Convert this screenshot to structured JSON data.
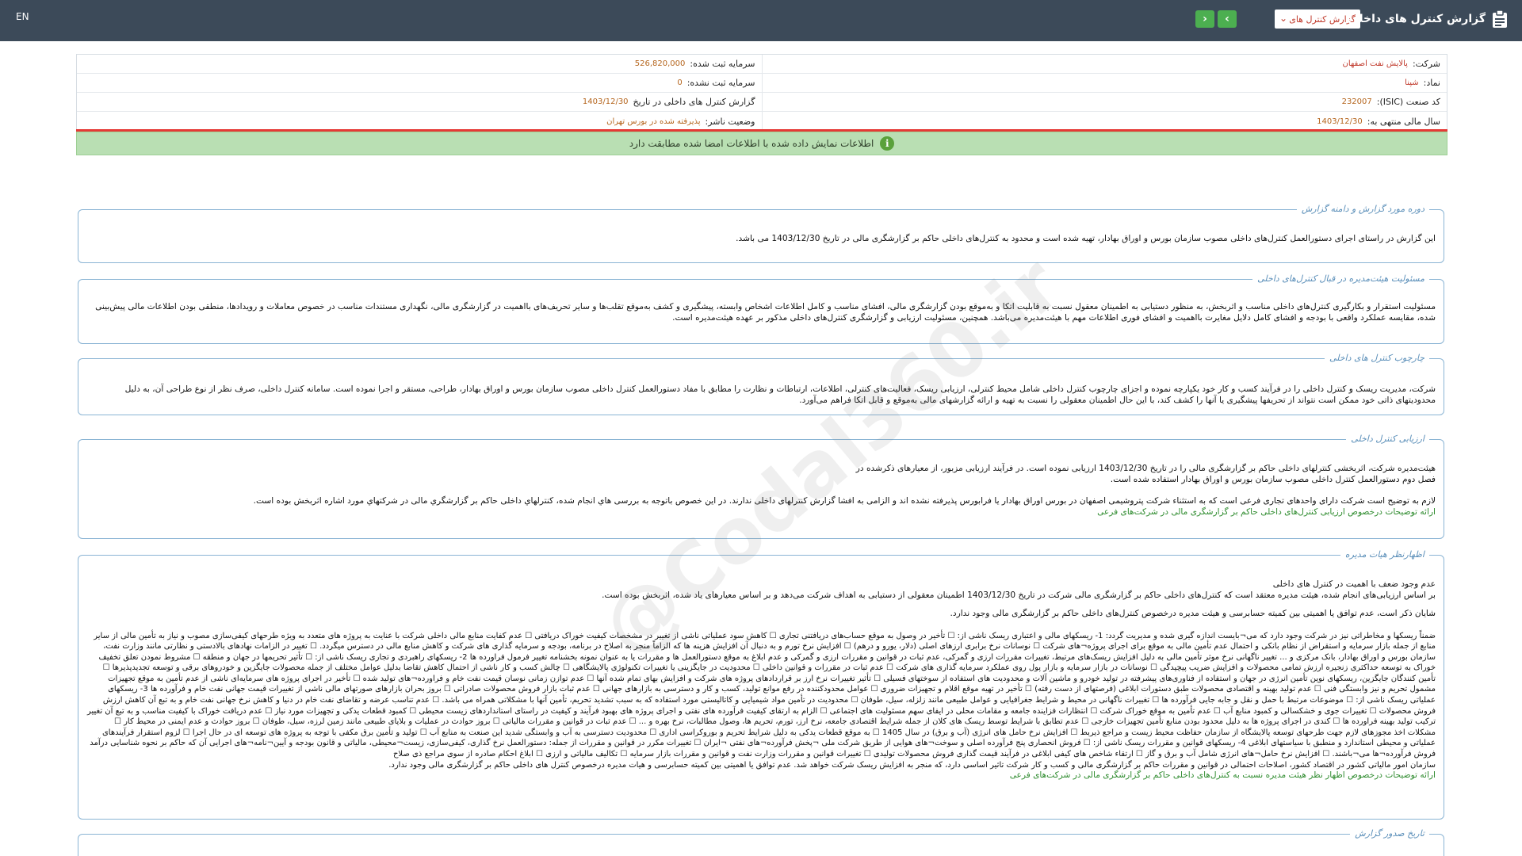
{
  "topbar": {
    "lang": "EN",
    "title": "گزارش کنترل های داخلی",
    "select_value": "گزارش کنترل های",
    "prev_label": "›",
    "next_label": "‹",
    "icon": "document-clipboard-icon",
    "bg_color": "#3c4a59"
  },
  "info": {
    "company_label": "شرکت:",
    "company_value": "پالایش نفت اصفهان",
    "capital_registered_label": "سرمایه ثبت شده:",
    "capital_registered_value": "526,820,000",
    "symbol_label": "نماد:",
    "symbol_value": "شپنا",
    "capital_unregistered_label": "سرمایه ثبت نشده:",
    "capital_unregistered_value": "0",
    "isic_label": "کد صنعت (ISIC):",
    "isic_value": "232007",
    "report_label": "گزارش کنترل های داخلی در تاریخ",
    "report_value": "1403/12/30",
    "fiscal_label": "سال مالی منتهی به:",
    "fiscal_value": "1403/12/30",
    "status_label": "وضعیت ناشر:",
    "status_value": "پذیرفته شده در بورس تهران"
  },
  "notice": {
    "text": "اطلاعات نمایش داده شده با اطلاعات امضا شده مطابقت دارد",
    "icon": "info-icon",
    "bg_color": "#b9dfb3"
  },
  "watermark": "@Codal360.ir",
  "sections": {
    "scope": {
      "title": "دوره مورد گزارش و دامنه گزارش",
      "text": "این گزارش در راستای اجرای دستورالعمل کنترل‌های داخلی مصوب سازمان بورس و اوراق بهادار، تهیه شده است و محدود به کنترل‌های داخلی حاکم بر گزارشگری مالی در تاریخ 1403/12/30 می باشد."
    },
    "board": {
      "title": "مسئولیت هیئت‌مدیره در قبال کنترل‌های داخلی",
      "text": "مسئولیت استقرار و بکارگیری کنترل‌های داخلی مناسب و اثربخش، به منظور دستیابی به اطمینان معقول نسبت به قابلیت اتکا و به‌موقع بودن گزارشگری مالی، افشای مناسب و کامل اطلاعات اشخاص وابسته، پیشگیری و کشف به‌موقع تقلب‌ها و سایر تحریف‌های بااهمیت در گزارشگری مالی، نگهداری مستندات مناسب در خصوص معاملات و رویدادها، منطقی بودن اطلاعات مالی پیش‌بینی شده، مقایسه عملکرد واقعی با بودجه و افشای کامل دلایل مغایرت بااهمیت و افشای فوری اطلاعات مهم با هیئت‌مدیره می‌باشد. همچنین، مسئولیت ارزیابی و گزارشگری کنترل‌های داخلی مذکور بر عهده هیئت‌مدیره است."
    },
    "framework": {
      "title": "چارچوب کنترل های داخلی",
      "text": "شرکت، مدیریت ریسک و کنترل داخلی را در فرآیند کسب و کار خود یکپارچه نموده و اجزای چارچوب کنترل داخلی شامل محیط کنترلی، ارزیابی ریسک، فعالیت‌های کنترلی، اطلاعات، ارتباطات و نظارت را مطابق با مفاد دستورالعمل کنترل داخلی مصوب سازمان بورس و اوراق بهادار، طراحی، مستقر و اجرا نموده است. سامانه کنترل داخلی، صرف نظر از نوع طراحی آن، به دلیل محدودیتهای ذاتی خود ممکن است نتواند از تحریفها پیشگیری یا آنها را کشف کند، با این حال اطمینان معقولی را نسبت به تهیه و ارائه گزارشهای مالی به‌موقع و قابل اتکا فراهم می‌آورد."
    },
    "evaluation": {
      "title": "ارزیابی کنترل داخلی",
      "line1": "هیئت‌مدیره شرکت، اثربخشی کنترلهای داخلی حاکم بر گزارشگری مالی را در تاریخ 1403/12/30 ارزیابی نموده است. در فرآیند ارزیابی مزبور، از معیارهای ذکرشده در",
      "line2": "فصل دوم دستورالعمل کنترل داخلی مصوب سازمان بورس و اوراق بهادار استفاده شده است.",
      "line3": "لازم به توضیح است شرکت دارای واحدهای تجاری فرعی است که به استثناء شرکت پتروشیمی اصفهان در بورس اوراق بهادار یا فرابورس پذیرفته نشده اند و الزامی به افشا گزارش کنترلهای داخلی ندارند. در این خصوص باتوجه به بررسی هاي انجام شده، کنترلهاي داخلی حاکم بر گزارشگري مالی در شرکتهاي مورد اشاره اثربخش بوده است.",
      "link": "ارائه توضیحات درخصوص ارزیابی کنترل‌های داخلی حاکم بر گزارشگری مالی در شرکت‌های فرعی"
    },
    "opinion": {
      "title": "اظهارنظر هیات مدیره",
      "line1": "عدم وجود ضعف با اهمیت در کنترل های داخلی",
      "line2": "بر اساس ارزیابی‌های انجام شده، هیئت مدیره معتقد است که کنترل‌های داخلی حاکم بر گزارشگری مالی شرکت در تاریخ 1403/12/30 اطمینان معقولی از دستیابی به اهداف شرکت می‌دهد و بر اساس معیارهای یاد شده، اثربخش بوده است.",
      "line3": "شایان ذکر است، عدم توافق یا اهمیتی بین کمیته حسابرسی و هیئت مدیره درخصوص کنترل‌های داخلی حاکم بر گزارشگری مالی وجود ندارد.",
      "para": "ضمناً ریسکها و مخاطراتی نیز در شرکت وجود دارد که می¬بایست اندازه گیری شده و مدیریت گردد: 1- ریسکهای مالی و اعتباری ریسک ناشی از: ☐ تأخیر در وصول به موقع حساب‌های دریافتنی تجاری ☐ کاهش سود عملیاتی ناشی از تغییر در مشخصات کیفیت خوراک دریافتی ☐ عدم کفایت منابع مالی داخلی شرکت با عنایت به پروژه های متعدد به ویژه طرحهای کیفی‌سازی مصوب و نیاز به تأمین مالی از سایر منابع از جمله بازار سرمایه و استقراض از نظام بانکی و احتمال عدم تأمین مالی به موقع برای اجرای پروژه¬های شرکت ☐ نوسانات نرخ برابری ارزهای اصلی (دلار، یورو و درهم) ☐ افزایش نرخ تورم و به دنبال آن افزایش هزینه ها که الزاماً منجر به اصلاح در برنامه، بودجه و سرمایه گذاری های شرکت و کاهش منابع مالی در دسترس میگردد. ☐ تغییر در الزامات نهادهای بالادستی و نظارتی مانند وزارت نفت، سازمان بورس و اوراق بهادار، بانک مرکزی و ... تغییر ناگهانی نرخ موثر تأمین مالی به دلیل افزایش ریسک‌های مرتبط، تغییرات مقررات ارزی و گمرکی، عدم ثبات در قوانین و مقررات ارزی و گمرکی و عدم ابلاغ به موقع دستورالعمل ها و مقررات یا به عنوان نمونه بخشنامه تغییر فرمول فراورده ها 2- ریسکهای راهبردی و تجاری ریسک ناشی از: ☐ تأثیر تحریمها در جهان و منطقه ☐ مشروط نمودن تعلق تخفیف خوراک به توسعه حداکثری زنجیره ارزش تمامی محصولات و افزایش ضریب پیچیدگی ☐ نوسانات در بازار سرمایه و بازار پول روی عملکرد سرمایه گذاری های شرکت ☐ عدم ثبات در مقررات و قوانین داخلی ☐ محدودیت در جایگزینی یا تغییرات تکنولوژی پالایشگاهی ☐ چالش کسب و کار ناشی از احتمال کاهش تقاضا بدلیل عوامل مختلف از جمله محصولات جایگزین و خودروهای برقی و توسعه تجدیدپذیرها ☐ تأمین کنندگان جایگزین، ریسکهای نوین تأمین انرژی در جهان و استفاده از فناوری‌های پیشرفته در تولید خودرو و ماشین آلات و محدودیت های استفاده از سوختهای فسیلی ☐ تأثیر تغییرات نرخ ارز بر قراردادهای پروژه های شرکت و افزایش بهای تمام شده آنها ☐ عدم توازن زمانی نوسان قیمت نفت خام و فراورده¬های تولید شده ☐ تأخیر در اجرای پروژه های سرمایه‌ای ناشی از عدم تأمین به موقع تجهیزات مشمول تحریم و نیز وابستگی فنی ☐ عدم تولید بهینه و اقتصادی محصولات طبق دستورات ابلاغی (فرصتهای از دست رفته) ☐ تأخیر در تهیه موقع اقلام و تجهیزات ضروری ☐ عوامل محدودکننده در رفع موانع تولید، کسب و کار و دسترسی به بازارهای جهانی ☐ عدم ثبات بازار فروش محصولات صادراتی ☐ بروز بحران بازارهای صورتهای مالی ناشی از تغییرات قیمت جهانی نفت خام و فرآورده ها 3- ریسکهای عملیاتی ریسک ناشی از: ☐ موضوعات مرتبط با حمل و نقل و جابه جایی فرآورده ها ☐ تغییرات ناگهانی در محیط و شرایط جغرافیایی و عوامل طبیعی مانند زلزله، سیل، طوفان ☐ محدودیت در تأمین مواد شیمیایی و کاتالیستی مورد استفاده که به سبب تشدید تحریم، تأمین آنها با مشکلاتی همراه می باشد. ☐ عدم تناسب عرضه و تقاضای نفت خام در دنیا و کاهش نرخ جهانی نفت خام و به تبع آن کاهش ارزش فروش محصولات ☐ تغییرات جوی و خشکسالی و کمبود منابع آب ☐ عدم تأمین به موقع خوراک شرکت ☐ انتظارات فزاینده جامعه و مقامات محلی در ایفای سهم مسئولیت های اجتماعی ☐ الزام به ارتقای کیفیت فرآورده های نفتی و اجرای پروژه های بهبود فرآیند و کیفیت در راستای استانداردهای زیست محیطی ☐ کمبود قطعات یدکی و تجهیزات مورد نیاز ☐ عدم دریافت خوراک با کیفیت مناسب و به تبع آن تغییر ترکیب تولید بهینه فراورده ها ☐ کندی در اجرای پروژه ها به دلیل محدود بودن منابع تأمین تجهیزات خارجی ☐ عدم تطابق با شرایط توسط ریسک های کلان از جمله شرایط اقتصادی جامعه، نرخ ارز، تورم، تحریم ها، وصول مطالبات، نرخ بهره و ... ☐ عدم ثبات در قوانین و مقررات مالیاتی ☐ بروز حوادث در عملیات و بلایای طبیعی مانند زمین لرزه، سیل، طوفان ☐ بروز حوادث و عدم ایمنی در محیط کار ☐ مشکلات اخذ مجوزهای لازم جهت طرحهای توسعه پالایشگاه از سازمان حفاظت محیط زیست و مراجع ذیربط ☐ افزایش نرخ حامل های انرژی (آب و برق) در سال 1405 ☐ به موقع قطعات یدکی به دلیل شرایط تحریم و بوروکراسی اداری ☐ محدودیت دسترسی به آب و وابستگی شدید این صنعت به منابع آب ☐ تولید و تأمین برق مکفی با توجه به پروژه های توسعه ای در حال اجرا ☐ لزوم استقرار فرآیندهای عملیاتی و محیطی استاندارد و منطبق با سیاستهای ابلاغی 4- ریسکهای قوانین و مقررات ریسک ناشی از: ☐ فروش انحصاری پنج فرآورده اصلی و سوخت¬های هوایی از طریق شرکت ملی ¬پخش فرآورده¬های نفتی ¬ایران ☐ تغییرات مکرر در قوانین و مقررات از جمله: دستورالعمل نرخ گذاری، کیفی‌سازی، زیست¬محیطی، مالیاتی و قانون بودجه و آیین¬نامه¬های اجرایی آن که حاکم بر نحوه شناسایی درآمد فروش فرآورده¬ها می¬باشند. ☐ افزایش نرخ حامل¬های انرژی شامل آب و برق و گاز ☐ ارتقاء شاخص های کیفی ابلاغی در فرآیند قیمت گذاری فروش محصولات تولیدی ☐ تغییرات قوانین و مقررات وزارت نفت و قوانین و مقررات بازار سرمایه ☐ تکالیف مالیاتی و ارزی ☐ ابلاغ احکام صادره از سوی مراجع ذی صلاح",
      "para_end": "سازمان امور مالیاتی کشور در اقتصاد کشور، اصلاحات احتمالی در قوانین و مقررات حاکم بر گزارشگری مالی و کسب و کار شرکت تاثیر اساسی دارد، که منجر به افزایش ریسک شرکت خواهد شد. عدم توافق یا اهمیتی بین کمیته حسابرسی و هیات مدیره درخصوص کنترل های داخلی حاکم بر گزارشگری مالی وجود ندارد.",
      "link": "ارائه توضیحات درخصوص اظهار نظر هیئت مدیره نسبت به کنترل‌های داخلی حاکم بر گزارشگری مالی در شرکت‌های فرعی"
    },
    "date": {
      "title": "تاریخ صدور گزارش"
    }
  }
}
